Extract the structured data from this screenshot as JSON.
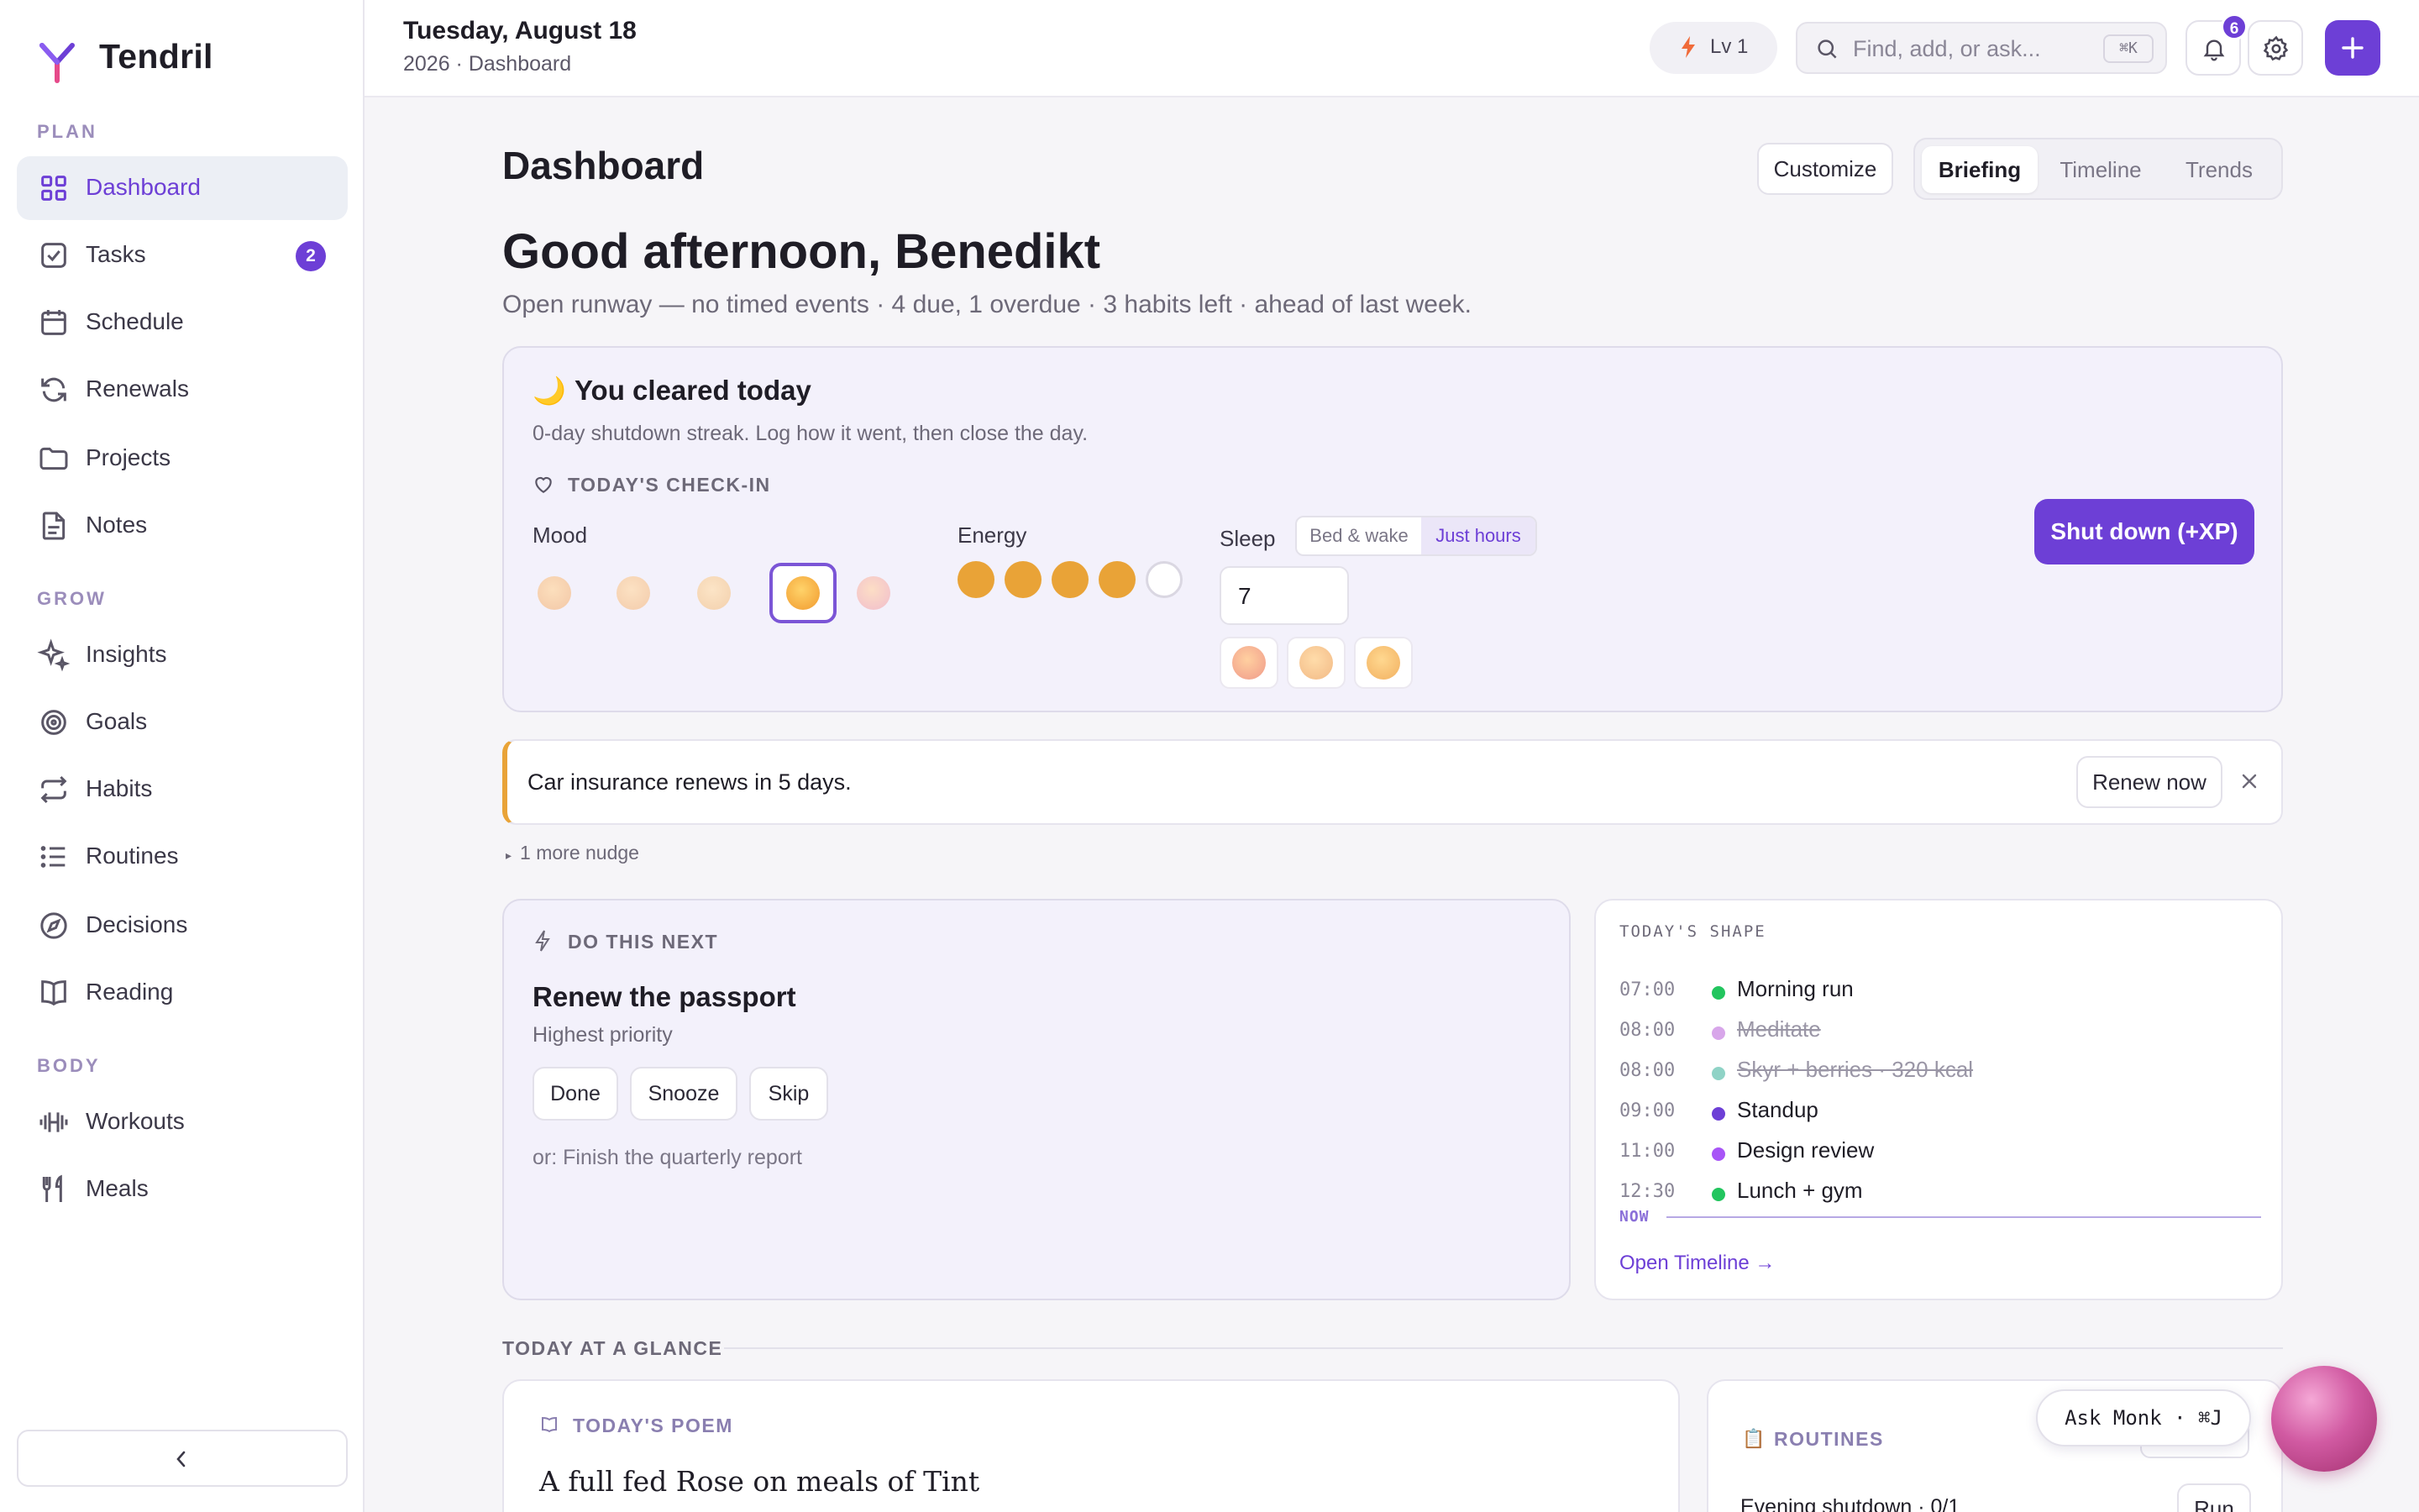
{
  "app": {
    "name": "Tendril"
  },
  "sidebar": {
    "sections": [
      {
        "label": "PLAN",
        "items": [
          {
            "label": "Dashboard",
            "icon": "grid-icon",
            "active": true
          },
          {
            "label": "Tasks",
            "icon": "checkbox-icon",
            "badge": "2"
          },
          {
            "label": "Schedule",
            "icon": "calendar-icon"
          },
          {
            "label": "Renewals",
            "icon": "refresh-icon"
          },
          {
            "label": "Projects",
            "icon": "folder-icon"
          },
          {
            "label": "Notes",
            "icon": "document-icon"
          }
        ]
      },
      {
        "label": "GROW",
        "items": [
          {
            "label": "Insights",
            "icon": "sparkle-icon"
          },
          {
            "label": "Goals",
            "icon": "target-icon"
          },
          {
            "label": "Habits",
            "icon": "repeat-icon"
          },
          {
            "label": "Routines",
            "icon": "list-icon"
          },
          {
            "label": "Decisions",
            "icon": "compass-icon"
          },
          {
            "label": "Reading",
            "icon": "book-icon"
          }
        ]
      },
      {
        "label": "BODY",
        "items": [
          {
            "label": "Workouts",
            "icon": "dumbbell-icon"
          },
          {
            "label": "Meals",
            "icon": "utensils-icon"
          }
        ]
      }
    ]
  },
  "topbar": {
    "date": "Tuesday, August 18",
    "subtitle": "2026 · Dashboard",
    "level": "Lv 1",
    "search_placeholder": "Find, add, or ask...",
    "search_shortcut": "⌘K",
    "notification_count": "6"
  },
  "page": {
    "title": "Dashboard",
    "customize": "Customize",
    "views": [
      "Briefing",
      "Timeline",
      "Trends"
    ],
    "active_view": "Briefing"
  },
  "greeting": {
    "title": "Good afternoon, Benedikt",
    "summary": "Open runway — no timed events · 4 due, 1 overdue · 3 habits left · ahead of last week."
  },
  "checkin": {
    "emoji": "🌙",
    "title": "You cleared today",
    "subtitle": "0-day shutdown streak. Log how it went, then close the day.",
    "section_label": "TODAY'S CHECK-IN",
    "mood_label": "Mood",
    "mood_selected": 4,
    "mood_count": 5,
    "energy_label": "Energy",
    "energy_level": 4,
    "energy_max": 5,
    "sleep_label": "Sleep",
    "sleep_modes": [
      "Bed & wake",
      "Just hours"
    ],
    "sleep_mode_active": "Just hours",
    "sleep_hours": "7",
    "shutdown_button": "Shut down (+XP)",
    "colors": {
      "accent": "#6d3fd6",
      "energy": "#e9a337"
    }
  },
  "nudge": {
    "text": "Car insurance renews in 5 days.",
    "action": "Renew now",
    "more": "1 more nudge"
  },
  "next": {
    "label": "DO THIS NEXT",
    "title": "Renew the passport",
    "subtitle": "Highest priority",
    "actions": [
      "Done",
      "Snooze",
      "Skip"
    ],
    "alternative": "or: Finish the quarterly report"
  },
  "shape": {
    "label": "TODAY'S SHAPE",
    "events": [
      {
        "time": "07:00",
        "name": "Morning run",
        "color": "#22c55e",
        "done": false
      },
      {
        "time": "08:00",
        "name": "Meditate",
        "color": "#d8a6ea",
        "done": true
      },
      {
        "time": "08:00",
        "name": "Skyr + berries · 320 kcal",
        "color": "#8fd3c6",
        "done": true
      },
      {
        "time": "09:00",
        "name": "Standup",
        "color": "#6d3fd6",
        "done": false
      },
      {
        "time": "11:00",
        "name": "Design review",
        "color": "#a855f7",
        "done": false
      },
      {
        "time": "12:30",
        "name": "Lunch + gym",
        "color": "#22c55e",
        "done": false
      }
    ],
    "now_label": "NOW",
    "link": "Open Timeline →"
  },
  "glance": {
    "label": "TODAY AT A GLANCE",
    "poem_label": "TODAY'S POEM",
    "poem_title": "A full fed Rose on meals of Tint",
    "routines_label": "ROUTINES",
    "routine_name": "Evening shutdown · 0/1",
    "routine_action": "Run"
  },
  "assistant": {
    "label": "Ask Monk · ⌘J"
  }
}
